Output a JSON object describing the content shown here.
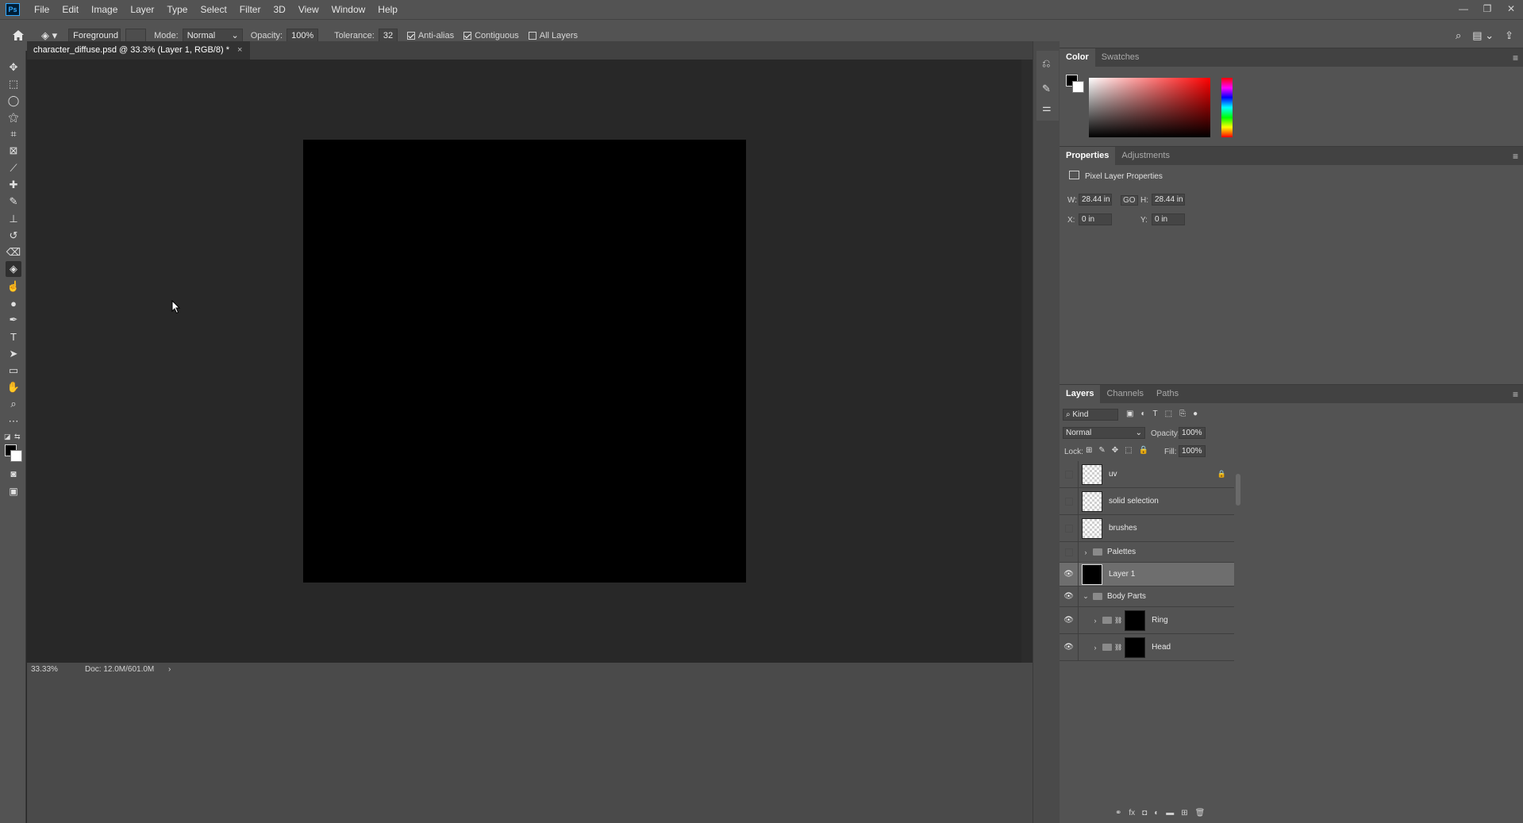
{
  "app": {
    "logo": "Ps",
    "menu": [
      "File",
      "Edit",
      "Image",
      "Layer",
      "Type",
      "Select",
      "Filter",
      "3D",
      "View",
      "Window",
      "Help"
    ],
    "window_controls": [
      "minimize-icon",
      "restore-icon",
      "close-icon"
    ]
  },
  "options_bar": {
    "fill_source": "Foreground",
    "mode_label": "Mode:",
    "mode_value": "Normal",
    "opacity_label": "Opacity:",
    "opacity_value": "100%",
    "tolerance_label": "Tolerance:",
    "tolerance_value": "32",
    "anti_alias_label": "Anti-alias",
    "anti_alias_checked": true,
    "contiguous_label": "Contiguous",
    "contiguous_checked": true,
    "all_layers_label": "All Layers",
    "all_layers_checked": false
  },
  "document": {
    "tab_title": "character_diffuse.psd @ 33.3% (Layer 1, RGB/8) *",
    "canvas_color": "#000000"
  },
  "status_bar": {
    "zoom": "33.33%",
    "doc_info": "Doc: 12.0M/601.0M",
    "arrow": "›"
  },
  "tools": [
    {
      "name": "move-tool-icon",
      "glyph": "✥"
    },
    {
      "name": "marquee-tool-icon",
      "glyph": "⬚"
    },
    {
      "name": "lasso-tool-icon",
      "glyph": "◯"
    },
    {
      "name": "magic-wand-tool-icon",
      "glyph": "⚝"
    },
    {
      "name": "crop-tool-icon",
      "glyph": "⌗"
    },
    {
      "name": "frame-tool-icon",
      "glyph": "⊠"
    },
    {
      "name": "eyedropper-tool-icon",
      "glyph": "⟋"
    },
    {
      "name": "healing-brush-tool-icon",
      "glyph": "✚"
    },
    {
      "name": "brush-tool-icon",
      "glyph": "✎"
    },
    {
      "name": "clone-stamp-tool-icon",
      "glyph": "⊥"
    },
    {
      "name": "history-brush-tool-icon",
      "glyph": "↺"
    },
    {
      "name": "eraser-tool-icon",
      "glyph": "⌫"
    },
    {
      "name": "paint-bucket-tool-icon",
      "glyph": "◈",
      "active": true
    },
    {
      "name": "smudge-tool-icon",
      "glyph": "☝"
    },
    {
      "name": "dodge-tool-icon",
      "glyph": "●"
    },
    {
      "name": "pen-tool-icon",
      "glyph": "✒"
    },
    {
      "name": "type-tool-icon",
      "glyph": "T"
    },
    {
      "name": "path-selection-tool-icon",
      "glyph": "➤"
    },
    {
      "name": "rectangle-tool-icon",
      "glyph": "▭"
    },
    {
      "name": "hand-tool-icon",
      "glyph": "✋"
    },
    {
      "name": "zoom-tool-icon",
      "glyph": "⌕"
    },
    {
      "name": "more-tools-icon",
      "glyph": "⋯"
    }
  ],
  "color_panel": {
    "tabs": [
      "Color",
      "Swatches"
    ],
    "active_tab": "Color",
    "foreground": "#000000",
    "background": "#ffffff",
    "hue": "#ff0000"
  },
  "properties_panel": {
    "tabs": [
      "Properties",
      "Adjustments"
    ],
    "heading": "Pixel Layer Properties",
    "w_label": "W:",
    "w_value": "28.44 in",
    "h_label": "H:",
    "h_value": "28.44 in",
    "x_label": "X:",
    "x_value": "0 in",
    "y_label": "Y:",
    "y_value": "0 in",
    "link_label": "GO"
  },
  "layers_panel": {
    "tabs": [
      "Layers",
      "Channels",
      "Paths"
    ],
    "filter_kind": "Kind",
    "blend_mode": "Normal",
    "opacity_label": "Opacity:",
    "opacity_value": "100%",
    "lock_label": "Lock:",
    "fill_label": "Fill:",
    "fill_value": "100%",
    "layers": [
      {
        "name": "uv",
        "visible": false,
        "type": "pixel",
        "locked": true
      },
      {
        "name": "solid selection",
        "visible": false,
        "type": "pixel"
      },
      {
        "name": "brushes",
        "visible": false,
        "type": "pixel"
      },
      {
        "name": "Palettes",
        "visible": false,
        "type": "group",
        "expanded": false
      },
      {
        "name": "Layer 1",
        "visible": true,
        "type": "pixel",
        "selected": true,
        "fill": "#000000"
      },
      {
        "name": "Body Parts",
        "visible": true,
        "type": "group",
        "expanded": true
      },
      {
        "name": "Ring",
        "visible": true,
        "type": "group-masked",
        "indent": 1
      },
      {
        "name": "Head",
        "visible": true,
        "type": "group-masked",
        "indent": 1
      }
    ],
    "footer_icons": [
      "link-layers-icon",
      "fx-icon",
      "add-mask-icon",
      "adjustment-layer-icon",
      "new-group-icon",
      "new-layer-icon",
      "delete-layer-icon"
    ],
    "footer_glyphs": [
      "⚭",
      "fx",
      "◘",
      "◐",
      "▬",
      "⊞",
      "🗑"
    ]
  }
}
